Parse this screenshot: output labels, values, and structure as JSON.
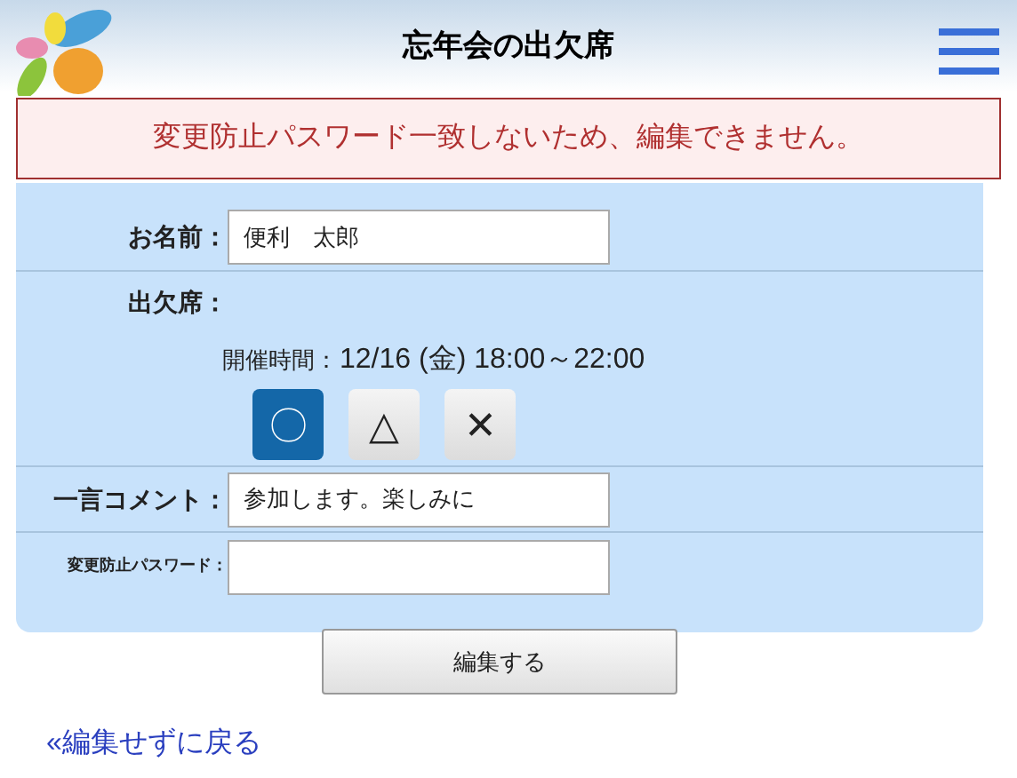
{
  "header": {
    "title": "忘年会の出欠席"
  },
  "alert": {
    "message": "変更防止パスワード一致しないため、編集できません。"
  },
  "form": {
    "name": {
      "label": "お名前：",
      "value": "便利　太郎"
    },
    "attendance": {
      "label": "出欠席：",
      "time_label": "開催時間：",
      "time_value": "12/16 (金) 18:00～22:00",
      "choices": [
        {
          "symbol": "〇",
          "selected": true
        },
        {
          "symbol": "△",
          "selected": false
        },
        {
          "symbol": "✕",
          "selected": false
        }
      ]
    },
    "comment": {
      "label": "一言コメント：",
      "value": "参加します。楽しみに"
    },
    "password": {
      "label": "変更防止パスワード："
    }
  },
  "submit_button": "編集する",
  "back_link": "«編集せずに戻る"
}
